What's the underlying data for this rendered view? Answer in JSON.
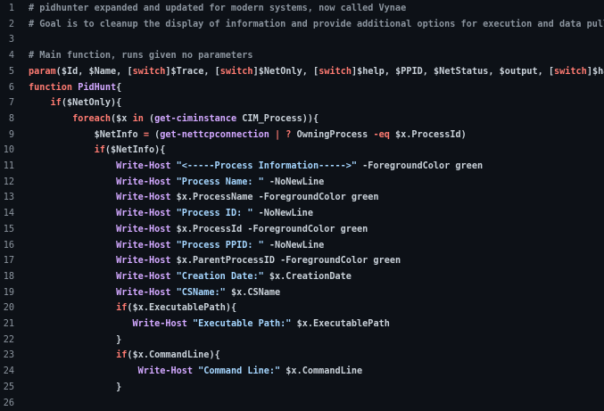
{
  "editor": {
    "start_line": 1,
    "lines": [
      [
        [
          "c",
          "# pidhunter expanded and updated for modern systems, now called Vynae"
        ]
      ],
      [
        [
          "c",
          "# Goal is to cleanup the display of information and provide additional options for execution and data pull"
        ]
      ],
      [],
      [
        [
          "c",
          "# Main function, runs given no parameters"
        ]
      ],
      [
        [
          "k",
          "param"
        ],
        [
          "p",
          "("
        ],
        [
          "v",
          "$Id"
        ],
        [
          "p",
          ", "
        ],
        [
          "v",
          "$Name"
        ],
        [
          "p",
          ", ["
        ],
        [
          "k",
          "switch"
        ],
        [
          "p",
          "]"
        ],
        [
          "v",
          "$Trace"
        ],
        [
          "p",
          ", ["
        ],
        [
          "k",
          "switch"
        ],
        [
          "p",
          "]"
        ],
        [
          "v",
          "$NetOnly"
        ],
        [
          "p",
          ", ["
        ],
        [
          "k",
          "switch"
        ],
        [
          "p",
          "]"
        ],
        [
          "v",
          "$help"
        ],
        [
          "p",
          ", "
        ],
        [
          "v",
          "$PPID"
        ],
        [
          "p",
          ", "
        ],
        [
          "v",
          "$NetStatus"
        ],
        [
          "p",
          ", "
        ],
        [
          "v",
          "$output"
        ],
        [
          "p",
          ", ["
        ],
        [
          "k",
          "switch"
        ],
        [
          "p",
          "]"
        ],
        [
          "v",
          "$hash"
        ],
        [
          "p",
          ")"
        ]
      ],
      [
        [
          "k",
          "function "
        ],
        [
          "f",
          "PidHunt"
        ],
        [
          "p",
          "{"
        ]
      ],
      [
        [
          "p",
          "    "
        ],
        [
          "k",
          "if"
        ],
        [
          "p",
          "("
        ],
        [
          "v",
          "$NetOnly"
        ],
        [
          "p",
          "){"
        ]
      ],
      [
        [
          "p",
          "        "
        ],
        [
          "k",
          "foreach"
        ],
        [
          "p",
          "("
        ],
        [
          "v",
          "$x"
        ],
        [
          "k",
          " in "
        ],
        [
          "p",
          "("
        ],
        [
          "f",
          "get-ciminstance"
        ],
        [
          "p",
          " CIM_Process)){"
        ]
      ],
      [
        [
          "p",
          "            "
        ],
        [
          "v",
          "$NetInfo"
        ],
        [
          "o",
          " = "
        ],
        [
          "p",
          "("
        ],
        [
          "f",
          "get-nettcpconnection"
        ],
        [
          "o",
          " | ? "
        ],
        [
          "p",
          "OwningProcess "
        ],
        [
          "o",
          "-eq "
        ],
        [
          "v",
          "$x"
        ],
        [
          "p",
          ".ProcessId)"
        ]
      ],
      [
        [
          "p",
          "            "
        ],
        [
          "k",
          "if"
        ],
        [
          "p",
          "("
        ],
        [
          "v",
          "$NetInfo"
        ],
        [
          "p",
          "){"
        ]
      ],
      [
        [
          "p",
          "                "
        ],
        [
          "f",
          "Write-Host "
        ],
        [
          "s",
          "\"<-----Process Information----->\""
        ],
        [
          "p",
          " -ForegroundColor green"
        ]
      ],
      [
        [
          "p",
          "                "
        ],
        [
          "f",
          "Write-Host "
        ],
        [
          "s",
          "\"Process Name: \""
        ],
        [
          "p",
          " -NoNewLine"
        ]
      ],
      [
        [
          "p",
          "                "
        ],
        [
          "f",
          "Write-Host "
        ],
        [
          "v",
          "$x"
        ],
        [
          "p",
          ".ProcessName -ForegroundColor green"
        ]
      ],
      [
        [
          "p",
          "                "
        ],
        [
          "f",
          "Write-Host "
        ],
        [
          "s",
          "\"Process ID: \""
        ],
        [
          "p",
          " -NoNewLine"
        ]
      ],
      [
        [
          "p",
          "                "
        ],
        [
          "f",
          "Write-Host "
        ],
        [
          "v",
          "$x"
        ],
        [
          "p",
          ".ProcessId -ForegroundColor green"
        ]
      ],
      [
        [
          "p",
          "                "
        ],
        [
          "f",
          "Write-Host "
        ],
        [
          "s",
          "\"Process PPID: \""
        ],
        [
          "p",
          " -NoNewLine"
        ]
      ],
      [
        [
          "p",
          "                "
        ],
        [
          "f",
          "Write-Host "
        ],
        [
          "v",
          "$x"
        ],
        [
          "p",
          ".ParentProcessID -ForegroundColor green"
        ]
      ],
      [
        [
          "p",
          "                "
        ],
        [
          "f",
          "Write-Host "
        ],
        [
          "s",
          "\"Creation Date:\""
        ],
        [
          "p",
          " "
        ],
        [
          "v",
          "$x"
        ],
        [
          "p",
          ".CreationDate"
        ]
      ],
      [
        [
          "p",
          "                "
        ],
        [
          "f",
          "Write-Host "
        ],
        [
          "s",
          "\"CSName:\""
        ],
        [
          "p",
          " "
        ],
        [
          "v",
          "$x"
        ],
        [
          "p",
          ".CSName"
        ]
      ],
      [
        [
          "p",
          "                "
        ],
        [
          "k",
          "if"
        ],
        [
          "p",
          "("
        ],
        [
          "v",
          "$x"
        ],
        [
          "p",
          ".ExecutablePath){"
        ]
      ],
      [
        [
          "p",
          "                   "
        ],
        [
          "f",
          "Write-Host "
        ],
        [
          "s",
          "\"Executable Path:\""
        ],
        [
          "p",
          " "
        ],
        [
          "v",
          "$x"
        ],
        [
          "p",
          ".ExecutablePath"
        ]
      ],
      [
        [
          "p",
          "                }"
        ]
      ],
      [
        [
          "p",
          "                "
        ],
        [
          "k",
          "if"
        ],
        [
          "p",
          "("
        ],
        [
          "v",
          "$x"
        ],
        [
          "p",
          ".CommandLine){"
        ]
      ],
      [
        [
          "p",
          "                    "
        ],
        [
          "f",
          "Write-Host "
        ],
        [
          "s",
          "\"Command Line:\""
        ],
        [
          "p",
          " "
        ],
        [
          "v",
          "$x"
        ],
        [
          "p",
          ".CommandLine"
        ]
      ],
      [
        [
          "p",
          "                }"
        ]
      ],
      []
    ]
  },
  "colors": {
    "background": "#0d1117",
    "line_number": "#8b949e",
    "comment": "#8b949e",
    "keyword": "#ff7b72",
    "function": "#d2a8ff",
    "string": "#a5d6ff",
    "text": "#c9d1d9"
  }
}
